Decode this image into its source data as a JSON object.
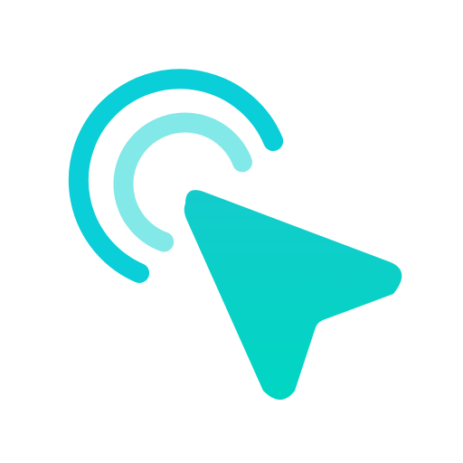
{
  "icon": {
    "name": "cursor-click-icon",
    "colors": {
      "outer_arc": "#0ACED8",
      "inner_arc": "#82E8E8",
      "cursor_top": "#13CCCC",
      "cursor_bottom": "#00D6C2",
      "background": "#FFFFFF"
    }
  }
}
